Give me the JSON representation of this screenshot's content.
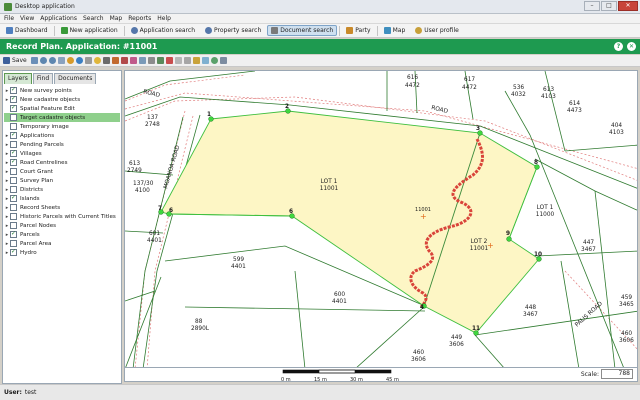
{
  "window": {
    "title": "Desktop application",
    "minimize": "–",
    "maximize": "□",
    "close": "✕"
  },
  "menu": [
    "File",
    "View",
    "Applications",
    "Search",
    "Map",
    "Reports",
    "Help"
  ],
  "nav": [
    {
      "label": "Dashboard",
      "icon": "home-icon",
      "color": "#4f7fbf"
    },
    {
      "label": "New application",
      "icon": "new-application-icon",
      "color": "#3a9a3a"
    },
    {
      "label": "Application search",
      "icon": "magnifier-icon",
      "color": "#5577aa"
    },
    {
      "label": "Property search",
      "icon": "magnifier-icon",
      "color": "#5577aa"
    },
    {
      "label": "Document search",
      "icon": "document-icon",
      "color": "#7a7a7a",
      "active": true
    },
    {
      "label": "Party",
      "icon": "people-icon",
      "color": "#c98a2b"
    },
    {
      "label": "Map",
      "icon": "map-icon",
      "color": "#3f8fbf"
    },
    {
      "label": "User profile",
      "icon": "user-icon",
      "color": "#c8a03a"
    }
  ],
  "header": {
    "title": "Record Plan. Application: #11001",
    "help": "?",
    "close": "✕"
  },
  "toolbar": {
    "save_label": "Save"
  },
  "tabs": [
    {
      "label": "Layers",
      "active": true
    },
    {
      "label": "Find",
      "active": false
    },
    {
      "label": "Documents",
      "active": false
    }
  ],
  "layers": [
    {
      "label": "New survey points",
      "checked": true,
      "expand": true
    },
    {
      "label": "New cadastre objects",
      "checked": true,
      "expand": true
    },
    {
      "label": "Spatial Feature Edit",
      "checked": true,
      "expand": false
    },
    {
      "label": "Target cadastre objects",
      "checked": false,
      "expand": false,
      "selected": true
    },
    {
      "label": "Temporary image",
      "checked": false,
      "expand": false
    },
    {
      "label": "Applications",
      "checked": true,
      "expand": true
    },
    {
      "label": "Pending Parcels",
      "checked": false,
      "expand": true
    },
    {
      "label": "Villages",
      "checked": true,
      "expand": true
    },
    {
      "label": "Road Centrelines",
      "checked": true,
      "expand": true
    },
    {
      "label": "Court Grant",
      "checked": false,
      "expand": true
    },
    {
      "label": "Survey Plan",
      "checked": false,
      "expand": true
    },
    {
      "label": "Districts",
      "checked": false,
      "expand": true
    },
    {
      "label": "Islands",
      "checked": true,
      "expand": true
    },
    {
      "label": "Record Sheets",
      "checked": false,
      "expand": true
    },
    {
      "label": "Historic Parcels with Current Titles",
      "checked": false,
      "expand": true
    },
    {
      "label": "Parcel Nodes",
      "checked": false,
      "expand": true
    },
    {
      "label": "Parcels",
      "checked": true,
      "expand": true
    },
    {
      "label": "Parcel Area",
      "checked": false,
      "expand": true
    },
    {
      "label": "Hydro",
      "checked": true,
      "expand": true
    }
  ],
  "map": {
    "roads": [
      "ROAD",
      "ROAD",
      "MOANOA ROAD",
      "PALIS ROAD"
    ],
    "nodes": [
      "1",
      "2",
      "3",
      "4",
      "6",
      "6",
      "7",
      "8",
      "9",
      "10",
      "11"
    ],
    "lot1": {
      "name": "LOT 1",
      "number": "11001"
    },
    "lot2": {
      "name": "LOT 2",
      "number": "11001"
    },
    "lot1_east": {
      "name": "LOT 1",
      "number": "11000"
    },
    "centroid_label": "11001",
    "parcels": [
      {
        "a": "137",
        "b": "2748"
      },
      {
        "a": "613",
        "b": "2749"
      },
      {
        "a": "137/30",
        "b": "4100"
      },
      {
        "a": "601",
        "b": "4401"
      },
      {
        "a": "616",
        "b": "4472"
      },
      {
        "a": "617",
        "b": "4472"
      },
      {
        "a": "536",
        "b": "4032"
      },
      {
        "a": "613",
        "b": "4103"
      },
      {
        "a": "614",
        "b": "4473"
      },
      {
        "a": "404",
        "b": "4103"
      },
      {
        "a": "599",
        "b": "4401"
      },
      {
        "a": "600",
        "b": "4401"
      },
      {
        "a": "88",
        "b": "2890L"
      },
      {
        "a": "447",
        "b": "3467"
      },
      {
        "a": "448",
        "b": "3467"
      },
      {
        "a": "449",
        "b": "3606"
      },
      {
        "a": "460",
        "b": "3606"
      },
      {
        "a": "459",
        "b": "3465"
      },
      {
        "a": "460",
        "b": "3606"
      }
    ]
  },
  "scale": {
    "ticks": [
      "0 m",
      "15 m",
      "30 m",
      "45 m"
    ],
    "label": "Scale:",
    "value": "788"
  },
  "status": {
    "label": "User:",
    "value": "test"
  },
  "colors": {
    "accent": "#1e9a50",
    "parcel_fill": "#fdf6c5",
    "boundary": "#3fbf3f",
    "hydro": "#d9443a"
  }
}
